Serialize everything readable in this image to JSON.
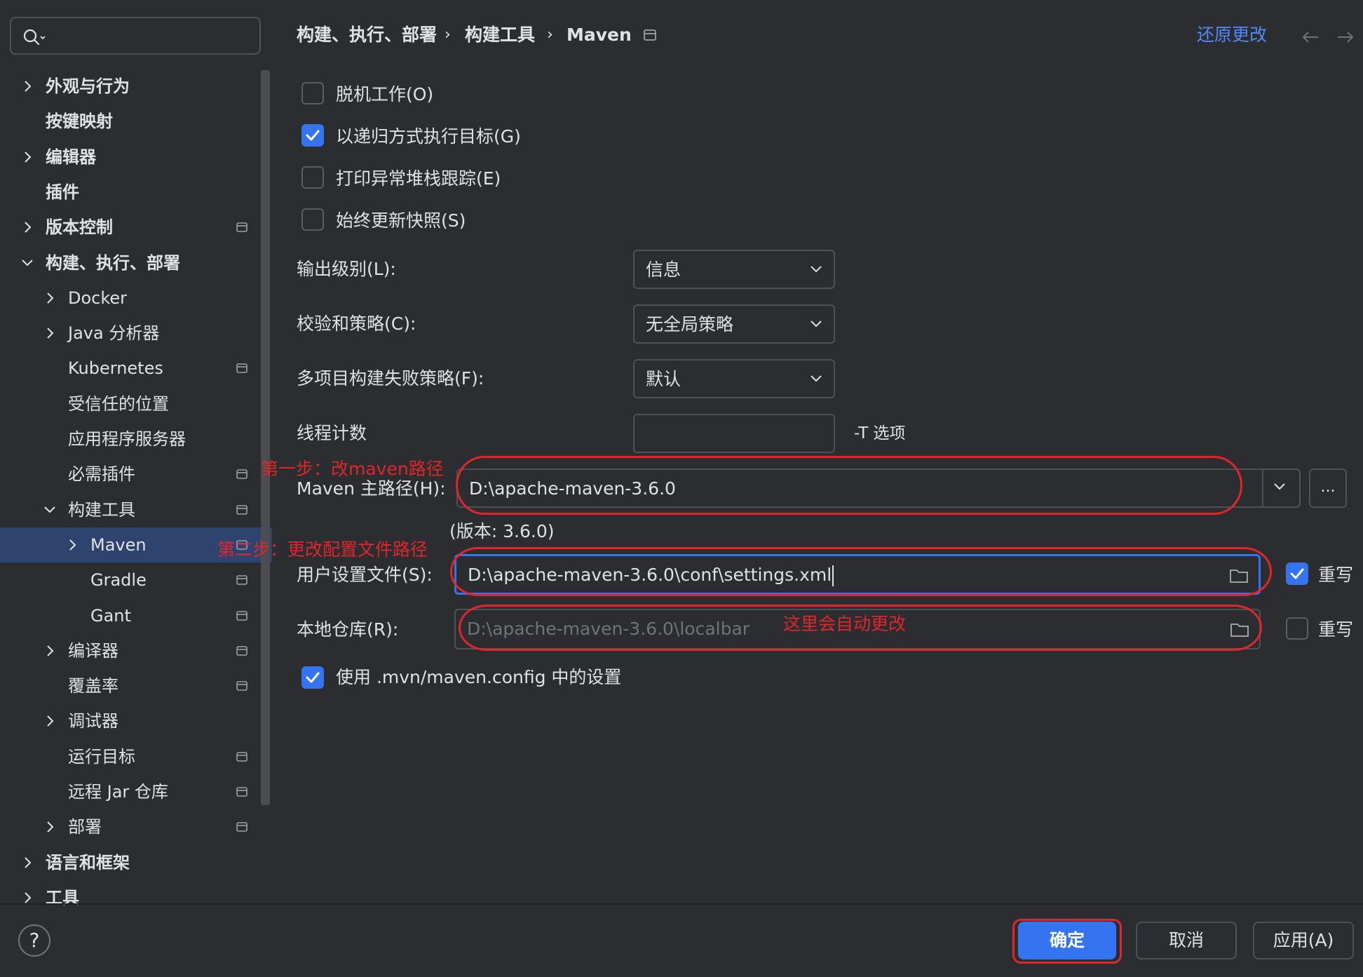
{
  "search": {
    "placeholder": ""
  },
  "sidebar": {
    "items": [
      {
        "label": "外观与行为",
        "expandable": true,
        "expanded": false,
        "pinned": false,
        "bold": true
      },
      {
        "label": "按键映射",
        "expandable": false,
        "pinned": false,
        "bold": true
      },
      {
        "label": "编辑器",
        "expandable": true,
        "expanded": false,
        "pinned": false,
        "bold": true
      },
      {
        "label": "插件",
        "expandable": false,
        "pinned": false,
        "bold": true
      },
      {
        "label": "版本控制",
        "expandable": true,
        "expanded": false,
        "pinned": true,
        "bold": true
      },
      {
        "label": "构建、执行、部署",
        "expandable": true,
        "expanded": true,
        "pinned": false,
        "bold": true
      },
      {
        "label": "Docker",
        "expandable": true,
        "expanded": false,
        "pinned": false
      },
      {
        "label": "Java 分析器",
        "expandable": true,
        "expanded": false,
        "pinned": false
      },
      {
        "label": "Kubernetes",
        "expandable": false,
        "pinned": true
      },
      {
        "label": "受信任的位置",
        "expandable": false,
        "pinned": false
      },
      {
        "label": "应用程序服务器",
        "expandable": false,
        "pinned": false
      },
      {
        "label": "必需插件",
        "expandable": false,
        "pinned": true
      },
      {
        "label": "构建工具",
        "expandable": true,
        "expanded": true,
        "pinned": true
      },
      {
        "label": "Maven",
        "expandable": true,
        "expanded": false,
        "pinned": true,
        "selected": true
      },
      {
        "label": "Gradle",
        "expandable": false,
        "pinned": true
      },
      {
        "label": "Gant",
        "expandable": false,
        "pinned": true
      },
      {
        "label": "编译器",
        "expandable": true,
        "expanded": false,
        "pinned": true
      },
      {
        "label": "覆盖率",
        "expandable": false,
        "pinned": true
      },
      {
        "label": "调试器",
        "expandable": true,
        "expanded": false,
        "pinned": false
      },
      {
        "label": "运行目标",
        "expandable": false,
        "pinned": true
      },
      {
        "label": "远程 Jar 仓库",
        "expandable": false,
        "pinned": true
      },
      {
        "label": "部署",
        "expandable": true,
        "expanded": false,
        "pinned": true
      },
      {
        "label": "语言和框架",
        "expandable": true,
        "expanded": false,
        "pinned": false,
        "bold": true
      },
      {
        "label": "工具",
        "expandable": true,
        "expanded": false,
        "pinned": false,
        "bold": true
      }
    ]
  },
  "header": {
    "breadcrumb": [
      "构建、执行、部署",
      "构建工具",
      "Maven"
    ],
    "separator": "›",
    "restore_label": "还原更改"
  },
  "form": {
    "offline": {
      "label": "脱机工作(O)",
      "checked": false
    },
    "recursive": {
      "label": "以递归方式执行目标(G)",
      "checked": true
    },
    "print_stack": {
      "label": "打印异常堆栈跟踪(E)",
      "checked": false
    },
    "update_snapshots": {
      "label": "始终更新快照(S)",
      "checked": false
    },
    "output_level": {
      "label": "输出级别(L):",
      "value": "信息"
    },
    "checksum_policy": {
      "label": "校验和策略(C):",
      "value": "无全局策略"
    },
    "multiproject_policy": {
      "label": "多项目构建失败策略(F):",
      "value": "默认"
    },
    "thread_count": {
      "label": "线程计数",
      "value": "",
      "suffix": "-T 选项"
    },
    "maven_home": {
      "label": "Maven 主路径(H):",
      "value": "D:\\apache-maven-3.6.0",
      "browse_label": "...",
      "version": "(版本: 3.6.0)"
    },
    "user_settings": {
      "label": "用户设置文件(S):",
      "value": "D:\\apache-maven-3.6.0\\conf\\settings.xml",
      "override_label": "重写",
      "override_checked": true
    },
    "local_repo": {
      "label": "本地仓库(R):",
      "value": "D:\\apache-maven-3.6.0\\localbar",
      "override_label": "重写",
      "override_checked": false
    },
    "use_mvn_config": {
      "label": "使用 .mvn/maven.config 中的设置",
      "checked": true
    }
  },
  "annotations": {
    "step1": "第一步：改maven路径",
    "step2": "第二步：更改配置文件路径",
    "auto_change": "这里会自动更改",
    "color": "#e0262b"
  },
  "footer": {
    "help_label": "?",
    "ok_label": "确定",
    "cancel_label": "取消",
    "apply_label": "应用(A)"
  },
  "colors": {
    "background": "#2b2d30",
    "accent": "#3574f0",
    "selected_row": "#2e436e",
    "link": "#548af7"
  }
}
